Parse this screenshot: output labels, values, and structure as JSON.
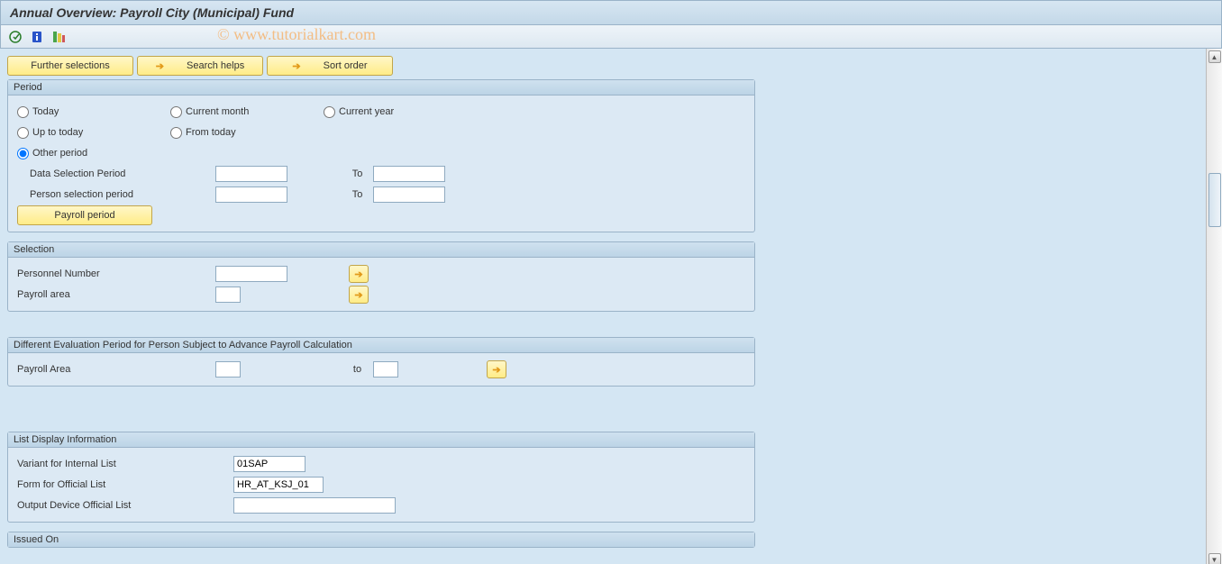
{
  "title": "Annual Overview: Payroll City (Municipal) Fund",
  "watermark": "© www.tutorialkart.com",
  "topbuttons": {
    "further": "Further selections",
    "searchhelps": "Search helps",
    "sortorder": "Sort order"
  },
  "period": {
    "header": "Period",
    "today": "Today",
    "current_month": "Current month",
    "current_year": "Current year",
    "up_to_today": "Up to today",
    "from_today": "From today",
    "other_period": "Other period",
    "data_sel": "Data Selection Period",
    "person_sel": "Person selection period",
    "to": "To",
    "payroll_period_btn": "Payroll period",
    "selected": "other_period"
  },
  "selection": {
    "header": "Selection",
    "personnel_number": "Personnel Number",
    "payroll_area": "Payroll area"
  },
  "diffeval": {
    "header": "Different Evaluation Period for Person Subject to Advance Payroll Calculation",
    "payroll_area": "Payroll Area",
    "to": "to"
  },
  "listdisp": {
    "header": "List Display Information",
    "variant": "Variant for Internal List",
    "variant_val": "01SAP",
    "form": "Form for Official List",
    "form_val": "HR_AT_KSJ_01",
    "output": "Output Device Official List",
    "output_val": ""
  },
  "issued": {
    "header": "Issued On"
  }
}
